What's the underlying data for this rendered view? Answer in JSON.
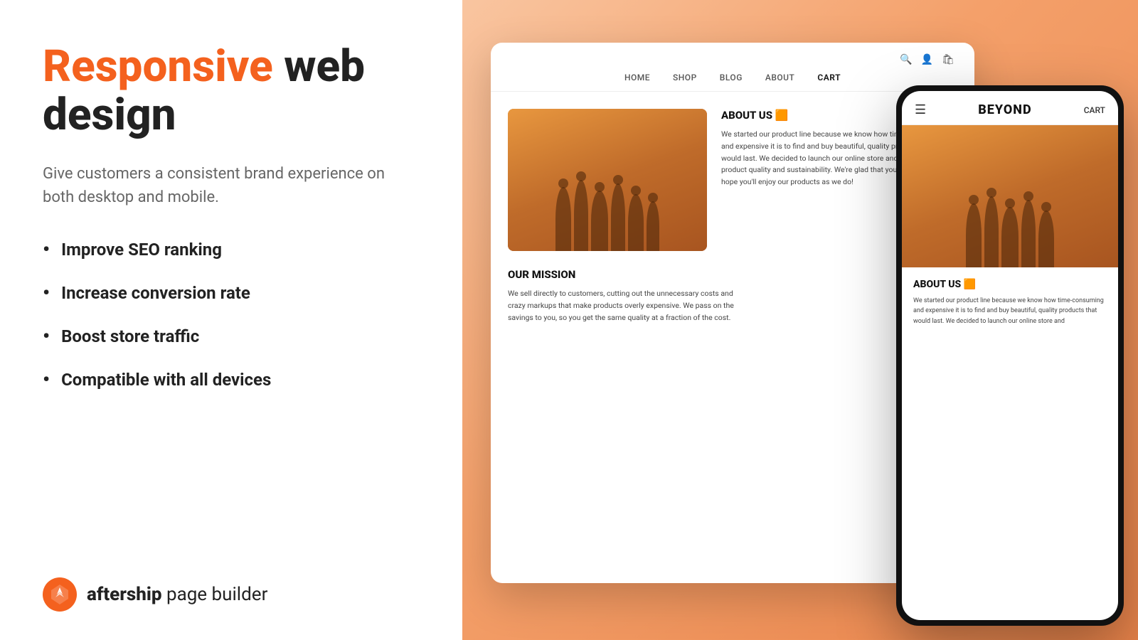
{
  "left": {
    "headline_highlight": "Responsive",
    "headline_rest": " web design",
    "description": "Give customers a consistent brand experience on both desktop and mobile.",
    "features": [
      "Improve SEO ranking",
      "Increase conversion rate",
      "Boost store traffic",
      "Compatible with all devices"
    ],
    "brand": {
      "name_bold": "aftership",
      "name_rest": " page builder"
    }
  },
  "desktop_mockup": {
    "nav_links": [
      "HOME",
      "SHOP",
      "BLOG",
      "ABOUT",
      "CART"
    ],
    "about_title": "ABOUT US 🟧",
    "about_body": "We started our product line because we know how time-consuming and expensive it is to find and buy beautiful, quality products that would last. We decided to launch our online store and focus mainly on product quality and sustainability. We're glad that you found us, and hope you'll enjoy our products as we do!",
    "mission_title": "OUR MISSION",
    "mission_body": "We sell directly to customers, cutting out the unnecessary costs and crazy markups that make products overly expensive. We pass on the savings to you, so you get the same quality at a fraction of the cost."
  },
  "mobile_mockup": {
    "brand": "BEYOND",
    "cart_label": "CART",
    "about_title": "ABOUT US 🟧",
    "about_body": "We started our product line because we know how time-consuming and expensive it is to find and buy beautiful, quality products that would last. We decided to launch our online store and"
  }
}
